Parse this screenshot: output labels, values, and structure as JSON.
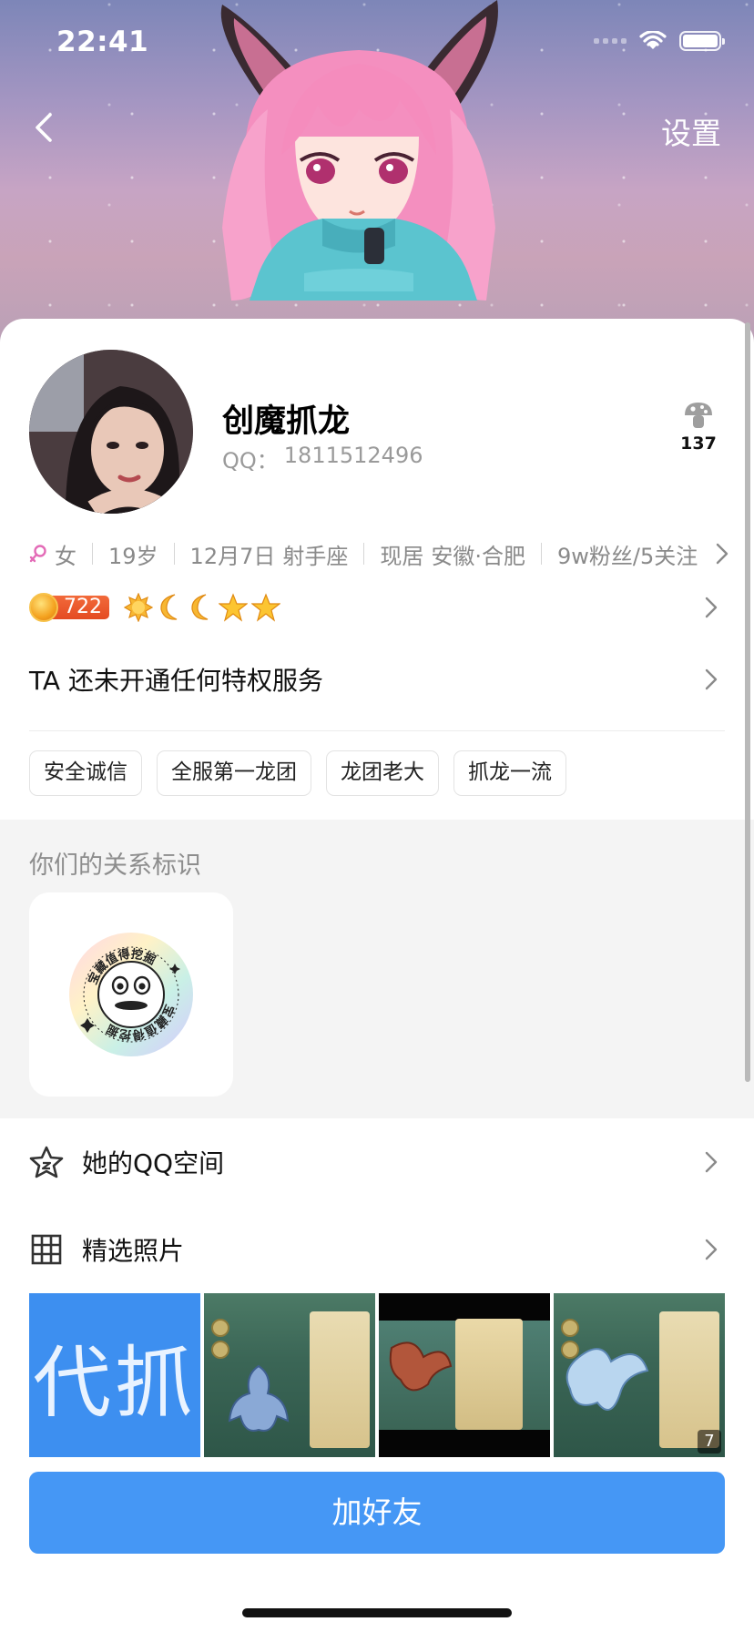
{
  "status_bar": {
    "time": "22:41"
  },
  "nav": {
    "settings_label": "设置",
    "back_icon": "chevron-left-icon"
  },
  "profile": {
    "nickname": "创魔抓龙",
    "qq_label": "QQ：",
    "qq_number": "1811512496",
    "likes_count": "137",
    "likes_icon": "mushroom-like-icon"
  },
  "info": {
    "gender": "女",
    "age": "19岁",
    "birthday": "12月7日",
    "zodiac": "射手座",
    "location_prefix": "现居",
    "location": "安徽·合肥",
    "followers": "9w粉丝/5关注"
  },
  "level": {
    "coin_value": "722",
    "icons": [
      "sun-icon",
      "moon-icon",
      "moon-icon",
      "star-icon",
      "star-icon"
    ]
  },
  "privilege_text": "TA 还未开通任何特权服务",
  "tags": [
    "安全诚信",
    "全服第一龙团",
    "龙团老大",
    "抓龙一流"
  ],
  "relation": {
    "title": "你们的关系标识",
    "badge_text": "宝藏值得挖掘"
  },
  "menu": {
    "qzone_label": "她的QQ空间",
    "photos_label": "精选照片"
  },
  "photos": {
    "first_text": "代抓",
    "count": "7"
  },
  "add_friend_label": "加好友",
  "colors": {
    "accent": "#4597f5",
    "coin": "#e44b22",
    "female": "#e36bb7"
  }
}
